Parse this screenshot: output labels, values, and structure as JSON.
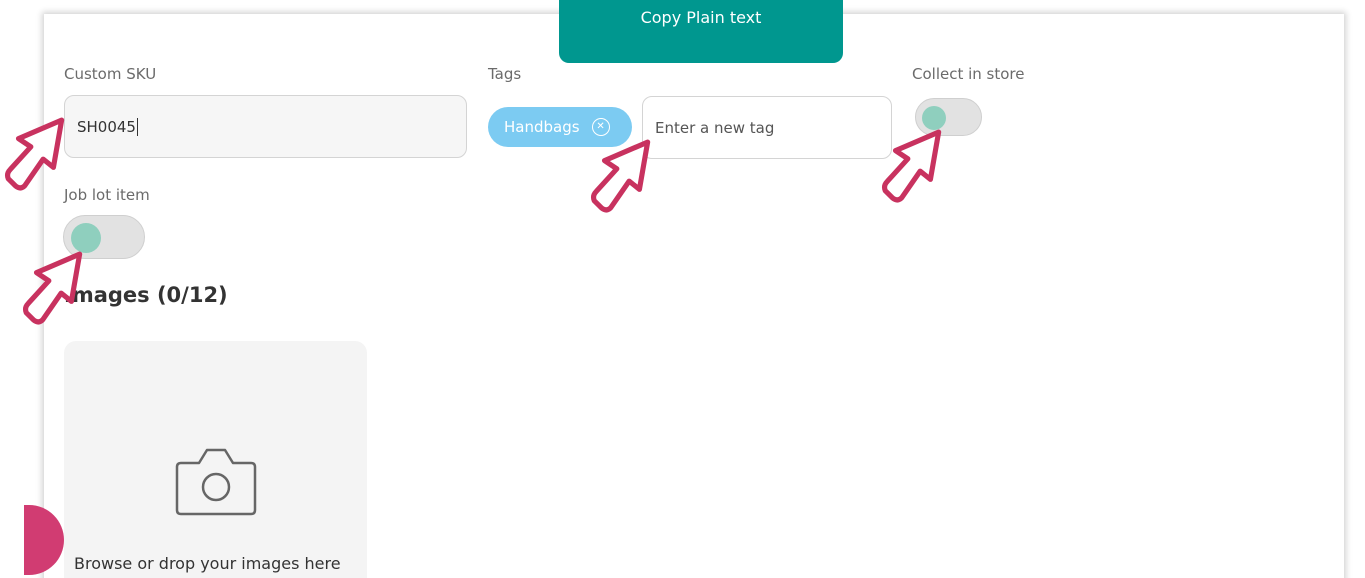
{
  "toolbar": {
    "copy_plain_label": "Copy Plain text"
  },
  "custom_sku": {
    "label": "Custom SKU",
    "value": "SH0045"
  },
  "tags": {
    "label": "Tags",
    "items": [
      {
        "label": "Handbags"
      }
    ],
    "input_placeholder": "Enter a new tag"
  },
  "collect_in_store": {
    "label": "Collect in store",
    "enabled": false
  },
  "job_lot": {
    "label": "Job lot item",
    "enabled": false
  },
  "images": {
    "title": "Images (0/12)",
    "drop_text": "Browse or drop your images here",
    "icon": "camera-icon"
  },
  "colors": {
    "accent": "#00978f",
    "tag_chip": "#7ccbf2",
    "toggle_knob": "#8fcfbe",
    "annotation_cursor": "#c8325f",
    "fab": "#d13c72"
  }
}
